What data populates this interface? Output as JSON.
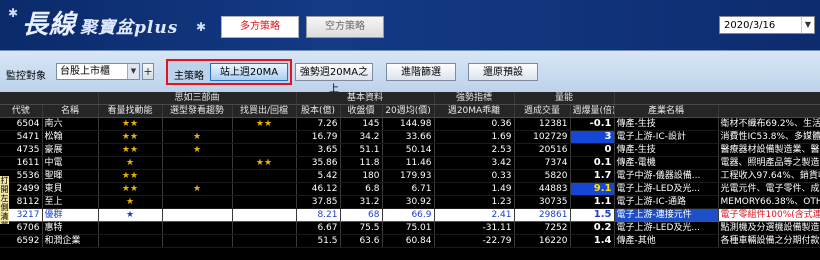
{
  "app": {
    "logo_main": "長線",
    "logo_sub": "聚寶盆plus",
    "strategy_long": "多方策略",
    "strategy_short": "空方策略",
    "date": "2020/3/16"
  },
  "toolbar": {
    "watch_label": "監控對象",
    "watch_value": "台股上市櫃",
    "add_symbol": "+",
    "strategy_label": "主策略",
    "strategy_selected": "站上週20MA",
    "strategy_alt": "強勢週20MA之上",
    "advanced_filter": "進階篩選",
    "reset": "還原預設"
  },
  "side_tag": "打開左側清單",
  "table": {
    "group_headers": [
      "思如三部曲",
      "基本資料",
      "強勢指標",
      "量能"
    ],
    "columns": [
      "代號",
      "名稱",
      "看量找動能",
      "選型發看趨勢",
      "找買出/回檔",
      "股本(億)",
      "收盤價",
      "20週均(價)",
      "週20MA乖離",
      "週成交量",
      "週爆量(倍)",
      "產業名稱",
      ""
    ],
    "rows": [
      {
        "code": "6504",
        "name": "南六",
        "s1": "★★",
        "s2": "",
        "s3": "★★",
        "cap": "7.26",
        "close": "145",
        "ma20": "144.98",
        "bias": "0.36",
        "vol": "12381",
        "burst": "-0.1",
        "ind": "傳產-生技",
        "desc": "衛材不織布69.2%、生活"
      },
      {
        "code": "5471",
        "name": "松翰",
        "s1": "★★",
        "s2": "★",
        "s3": "",
        "cap": "16.79",
        "close": "34.2",
        "ma20": "33.66",
        "bias": "1.69",
        "vol": "102729",
        "burst": "3",
        "ind": "電子上游-IC-設計",
        "desc": "消費性IC53.8%、多媒體"
      },
      {
        "code": "4735",
        "name": "豪展",
        "s1": "★★",
        "s2": "★",
        "s3": "",
        "cap": "3.65",
        "close": "51.1",
        "ma20": "50.14",
        "bias": "2.53",
        "vol": "20516",
        "burst": "0",
        "ind": "傳產-生技",
        "desc": "醫療器材設備製造業、醫"
      },
      {
        "code": "1611",
        "name": "中電",
        "s1": "★",
        "s2": "",
        "s3": "★★",
        "cap": "35.86",
        "close": "11.8",
        "ma20": "11.46",
        "bias": "3.42",
        "vol": "7374",
        "burst": "0.1",
        "ind": "傳產-電機",
        "desc": "電器、照明產品等之製造"
      },
      {
        "code": "5536",
        "name": "聖暉",
        "s1": "★★",
        "s2": "",
        "s3": "",
        "cap": "5.42",
        "close": "180",
        "ma20": "179.93",
        "bias": "0.33",
        "vol": "5820",
        "burst": "1.7",
        "ind": "電子中游-儀器設備...",
        "desc": "工程收入97.64%、銷貨收"
      },
      {
        "code": "2499",
        "name": "東貝",
        "s1": "★★",
        "s2": "★",
        "s3": "",
        "cap": "46.12",
        "close": "6.8",
        "ma20": "6.71",
        "bias": "1.49",
        "vol": "44883",
        "burst": "9.1",
        "ind": "電子上游-LED及光...",
        "desc": "光電元件、電子零件、成品"
      },
      {
        "code": "8112",
        "name": "至上",
        "s1": "★",
        "s2": "",
        "s3": "",
        "cap": "37.85",
        "close": "31.2",
        "ma20": "30.92",
        "bias": "1.23",
        "vol": "30735",
        "burst": "1.1",
        "ind": "電子上游-IC-通路",
        "desc": "MEMORY66.38%、OTHE"
      },
      {
        "code": "3217",
        "name": "優群",
        "s1": "★",
        "s2": "",
        "s3": "",
        "cap": "8.21",
        "close": "68",
        "ma20": "66.9",
        "bias": "2.41",
        "vol": "29861",
        "burst": "1.5",
        "ind": "電子上游-連接元件",
        "desc": "電子零組件100%(含式連接"
      },
      {
        "code": "6706",
        "name": "惠特",
        "s1": "",
        "s2": "",
        "s3": "",
        "cap": "6.67",
        "close": "75.5",
        "ma20": "75.01",
        "bias": "-31.11",
        "vol": "7252",
        "burst": "0.2",
        "ind": "電子上游-LED及光...",
        "desc": "點測機及分選機設備製造"
      },
      {
        "code": "6592",
        "name": "和潤企業",
        "s1": "",
        "s2": "",
        "s3": "",
        "cap": "51.5",
        "close": "63.6",
        "ma20": "60.84",
        "bias": "-22.79",
        "vol": "16220",
        "burst": "1.4",
        "ind": "傳產-其他",
        "desc": "各種車輛設備之分期付款"
      }
    ]
  },
  "colors": {
    "banner": "#143a86",
    "accent_red": "#e0141e",
    "highlight_blue": "#1646d8",
    "star": "#e8b400"
  }
}
